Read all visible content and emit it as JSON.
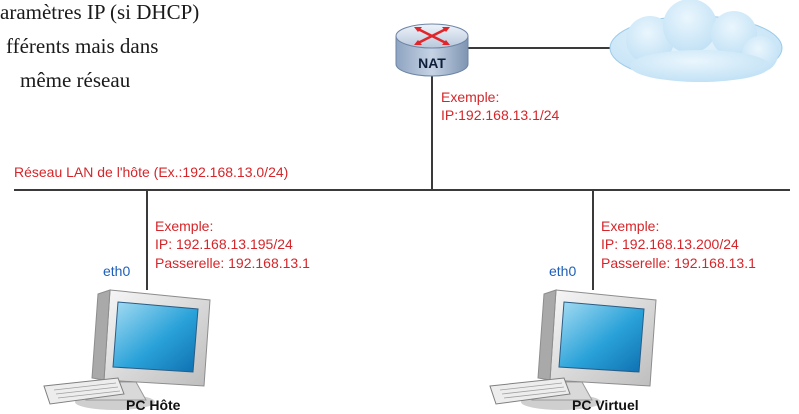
{
  "header_text": {
    "line1": "aramètres IP (si DHCP)",
    "line2": "fférents mais dans",
    "line3": "même réseau"
  },
  "router": {
    "label": "NAT",
    "example_title": "Exemple:",
    "example_ip": "IP:192.168.13.1/24"
  },
  "network": {
    "label": "Réseau LAN de l'hôte (Ex.:192.168.13.0/24)"
  },
  "host_pc": {
    "example_title": "Exemple:",
    "ip": "IP: 192.168.13.195/24",
    "gateway": "Passerelle: 192.168.13.1",
    "interface": "eth0",
    "name": "PC Hôte"
  },
  "virtual_pc": {
    "example_title": "Exemple:",
    "ip": "IP: 192.168.13.200/24",
    "gateway": "Passerelle: 192.168.13.1",
    "interface": "eth0",
    "name": "PC Virtuel"
  },
  "colors": {
    "annotation": "#d4262a",
    "interface_label": "#1f5fb8",
    "line": "#3a3a3a",
    "router_body": "#a9bbd2"
  },
  "icons": {
    "router": "router-icon",
    "internet": "cloud-icon",
    "computer": "desktop-computer-icon"
  }
}
